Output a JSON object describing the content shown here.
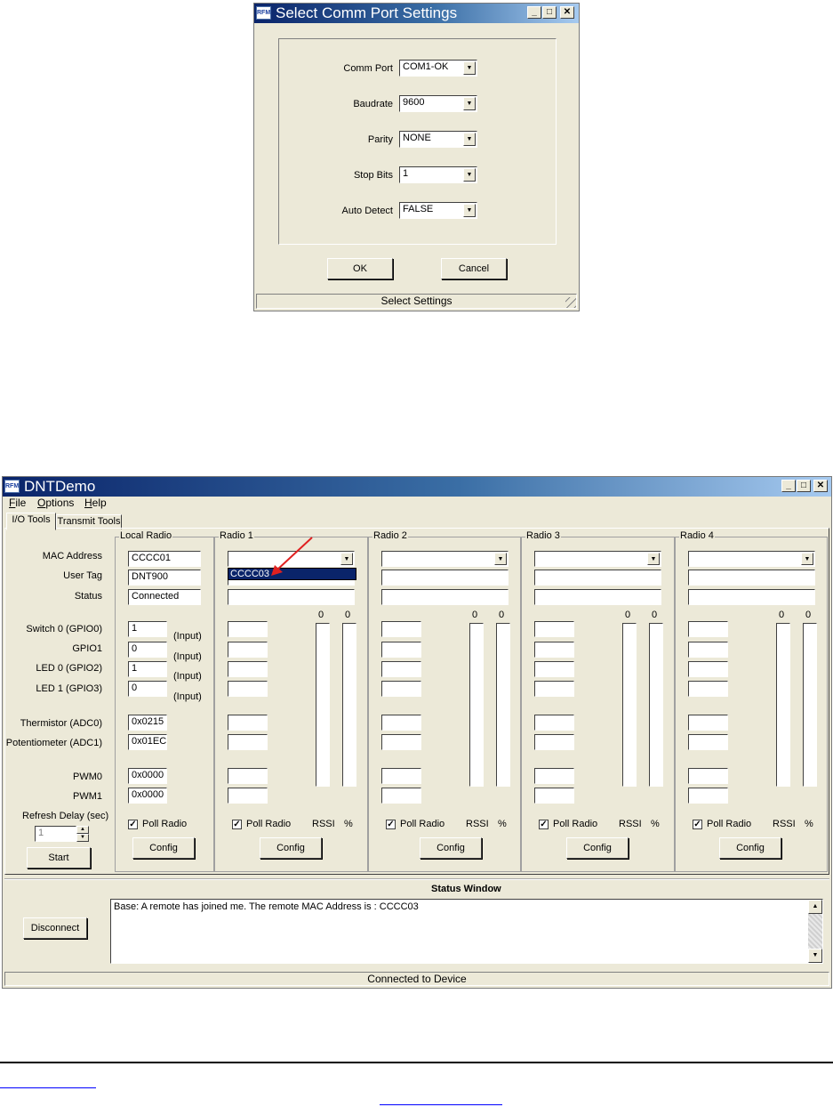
{
  "dialog": {
    "title": "Select Comm Port Settings",
    "icon_text": "RFM",
    "fields": [
      {
        "label": "Comm Port",
        "value": "COM1-OK"
      },
      {
        "label": "Baudrate",
        "value": "9600"
      },
      {
        "label": "Parity",
        "value": "NONE"
      },
      {
        "label": "Stop Bits",
        "value": "1"
      },
      {
        "label": "Auto Detect",
        "value": "FALSE"
      }
    ],
    "ok_label": "OK",
    "cancel_label": "Cancel",
    "status": "Select Settings"
  },
  "app": {
    "title": "DNTDemo",
    "icon_text": "RFM",
    "menu": {
      "file": {
        "hotkey": "F",
        "rest": "ile"
      },
      "options": {
        "hotkey": "O",
        "rest": "ptions"
      },
      "help": {
        "hotkey": "H",
        "rest": "elp"
      }
    },
    "tabs": [
      "I/O Tools",
      "Transmit Tools"
    ],
    "row_labels": {
      "mac": "MAC Address",
      "tag": "User Tag",
      "status": "Status",
      "sw0": "Switch 0 (GPIO0)",
      "gpio1": "GPIO1",
      "led0": "LED 0 (GPIO2)",
      "led1": "LED 1 (GPIO3)",
      "therm": "Thermistor (ADC0)",
      "pot": "Potentiometer (ADC1)",
      "pwm0": "PWM0",
      "pwm1": "PWM1",
      "refresh": "Refresh Delay (sec)"
    },
    "refresh_value": "1",
    "start_label": "Start",
    "local": {
      "title": "Local Radio",
      "mac": "CCCC01",
      "tag": "DNT900",
      "status": "Connected",
      "io": [
        "1",
        "0",
        "1",
        "0"
      ],
      "io_dir": [
        "(Input)",
        "(Input)",
        "(Input)",
        "(Input)"
      ],
      "adc0": "0x0215",
      "adc1": "0x01EC",
      "pwm0": "0x0000",
      "pwm1": "0x0000",
      "poll_label": "Poll Radio",
      "config_label": "Config"
    },
    "radios": [
      {
        "title": "Radio 1",
        "rssi_value": "0",
        "pct_value": "0",
        "rssi_level": 0,
        "pct_level": 0
      },
      {
        "title": "Radio 2",
        "rssi_value": "0",
        "pct_value": "0",
        "rssi_level": 0,
        "pct_level": 0
      },
      {
        "title": "Radio 3",
        "rssi_value": "0",
        "pct_value": "0",
        "rssi_level": 0,
        "pct_level": 0
      },
      {
        "title": "Radio 4",
        "rssi_value": "0",
        "pct_value": "0",
        "rssi_level": 0,
        "pct_level": 0
      }
    ],
    "radio_poll_label": "Poll Radio",
    "radio_config_label": "Config",
    "rssi_label": "RSSI",
    "pct_label": "%",
    "dropdown_option": "CCCC03",
    "status_window": {
      "title": "Status Window",
      "text": "Base:  A remote has joined me.  The remote MAC Address is : CCCC03"
    },
    "disconnect_label": "Disconnect",
    "statusbar": "Connected to Device"
  },
  "colors": {
    "title_start": "#0a246a",
    "title_end": "#a6caf0",
    "face": "#ece9d8",
    "selection": "#0a246a",
    "arrow": "#e02020"
  }
}
